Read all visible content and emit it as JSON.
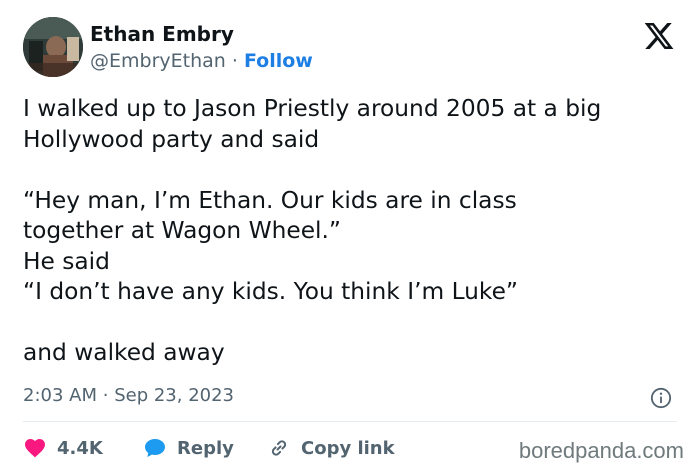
{
  "author": {
    "name": "Ethan Embry",
    "handle": "@EmbryEthan",
    "separator": "·",
    "follow_label": "Follow",
    "avatar_icon": "profile-photo"
  },
  "platform_icon": "x-logo-icon",
  "tweet": {
    "lines": [
      "I walked up to Jason Priestly around 2005 at a big",
      "Hollywood party and said",
      "",
      "“Hey man, I’m Ethan. Our kids are in class",
      "together at Wagon Wheel.”",
      "He said",
      "“I don’t have any kids. You think I’m Luke”",
      "",
      "and walked away"
    ]
  },
  "meta": {
    "time": "2:03 AM",
    "separator": "·",
    "date": "Sep 23, 2023"
  },
  "actions": {
    "likes": "4.4K",
    "reply_label": "Reply",
    "copy_link_label": "Copy link"
  },
  "colors": {
    "like": "#f91880",
    "reply": "#1d9bf0",
    "follow": "#1d7fe4",
    "muted": "#536471"
  },
  "watermark": "boredpanda.com"
}
